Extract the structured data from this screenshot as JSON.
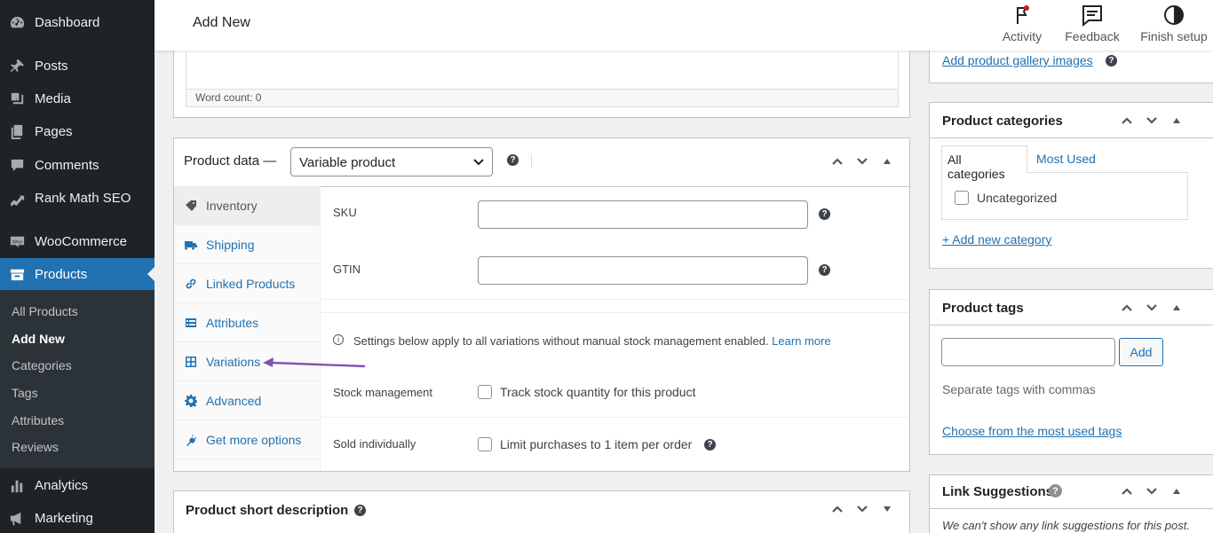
{
  "sidebar": {
    "items": [
      {
        "label": "Dashboard",
        "icon": "dashboard-icon"
      },
      {
        "label": "Posts",
        "icon": "pin-icon"
      },
      {
        "label": "Media",
        "icon": "media-icon"
      },
      {
        "label": "Pages",
        "icon": "pages-icon"
      },
      {
        "label": "Comments",
        "icon": "comments-icon"
      },
      {
        "label": "Rank Math SEO",
        "icon": "rank-math-icon"
      },
      {
        "label": "WooCommerce",
        "icon": "woocommerce-icon"
      },
      {
        "label": "Products",
        "icon": "products-icon"
      },
      {
        "label": "Analytics",
        "icon": "analytics-icon"
      },
      {
        "label": "Marketing",
        "icon": "marketing-icon"
      }
    ],
    "submenu": [
      "All Products",
      "Add New",
      "Categories",
      "Tags",
      "Attributes",
      "Reviews"
    ]
  },
  "topbar": {
    "title": "Add New",
    "buttons": [
      {
        "label": "Activity",
        "icon": "flag-icon"
      },
      {
        "label": "Feedback",
        "icon": "feedback-icon"
      },
      {
        "label": "Finish setup",
        "icon": "half-circle-icon"
      }
    ]
  },
  "editor": {
    "word_count": "Word count: 0"
  },
  "product_data": {
    "title": "Product data —",
    "type_selected": "Variable product",
    "tabs": [
      {
        "label": "Inventory",
        "icon": "inventory-icon"
      },
      {
        "label": "Shipping",
        "icon": "truck-icon"
      },
      {
        "label": "Linked Products",
        "icon": "link-icon"
      },
      {
        "label": "Attributes",
        "icon": "attributes-icon"
      },
      {
        "label": "Variations",
        "icon": "grid-icon"
      },
      {
        "label": "Advanced",
        "icon": "gear-icon"
      },
      {
        "label": "Get more options",
        "icon": "plug-icon"
      }
    ],
    "fields": {
      "sku_label": "SKU",
      "gtin_label": "GTIN",
      "notice": "Settings below apply to all variations without manual stock management enabled.",
      "learn_more": "Learn more",
      "stock_label": "Stock management",
      "stock_checkbox": "Track stock quantity for this product",
      "sold_label": "Sold individually",
      "sold_checkbox": "Limit purchases to 1 item per order"
    }
  },
  "short_description": {
    "title": "Product short description"
  },
  "gallery": {
    "link": "Add product gallery images"
  },
  "categories": {
    "title": "Product categories",
    "tabs": [
      "All categories",
      "Most Used"
    ],
    "items": [
      "Uncategorized"
    ],
    "add_link": "+ Add new category"
  },
  "tags": {
    "title": "Product tags",
    "add_button": "Add",
    "hint": "Separate tags with commas",
    "choose_link": "Choose from the most used tags"
  },
  "link_suggestions": {
    "title": "Link Suggestions",
    "message": "We can't show any link suggestions for this post."
  },
  "colors": {
    "sidebar_bg": "#1d2327",
    "accent": "#2271b1",
    "annotation_arrow": "#7f54b3"
  }
}
